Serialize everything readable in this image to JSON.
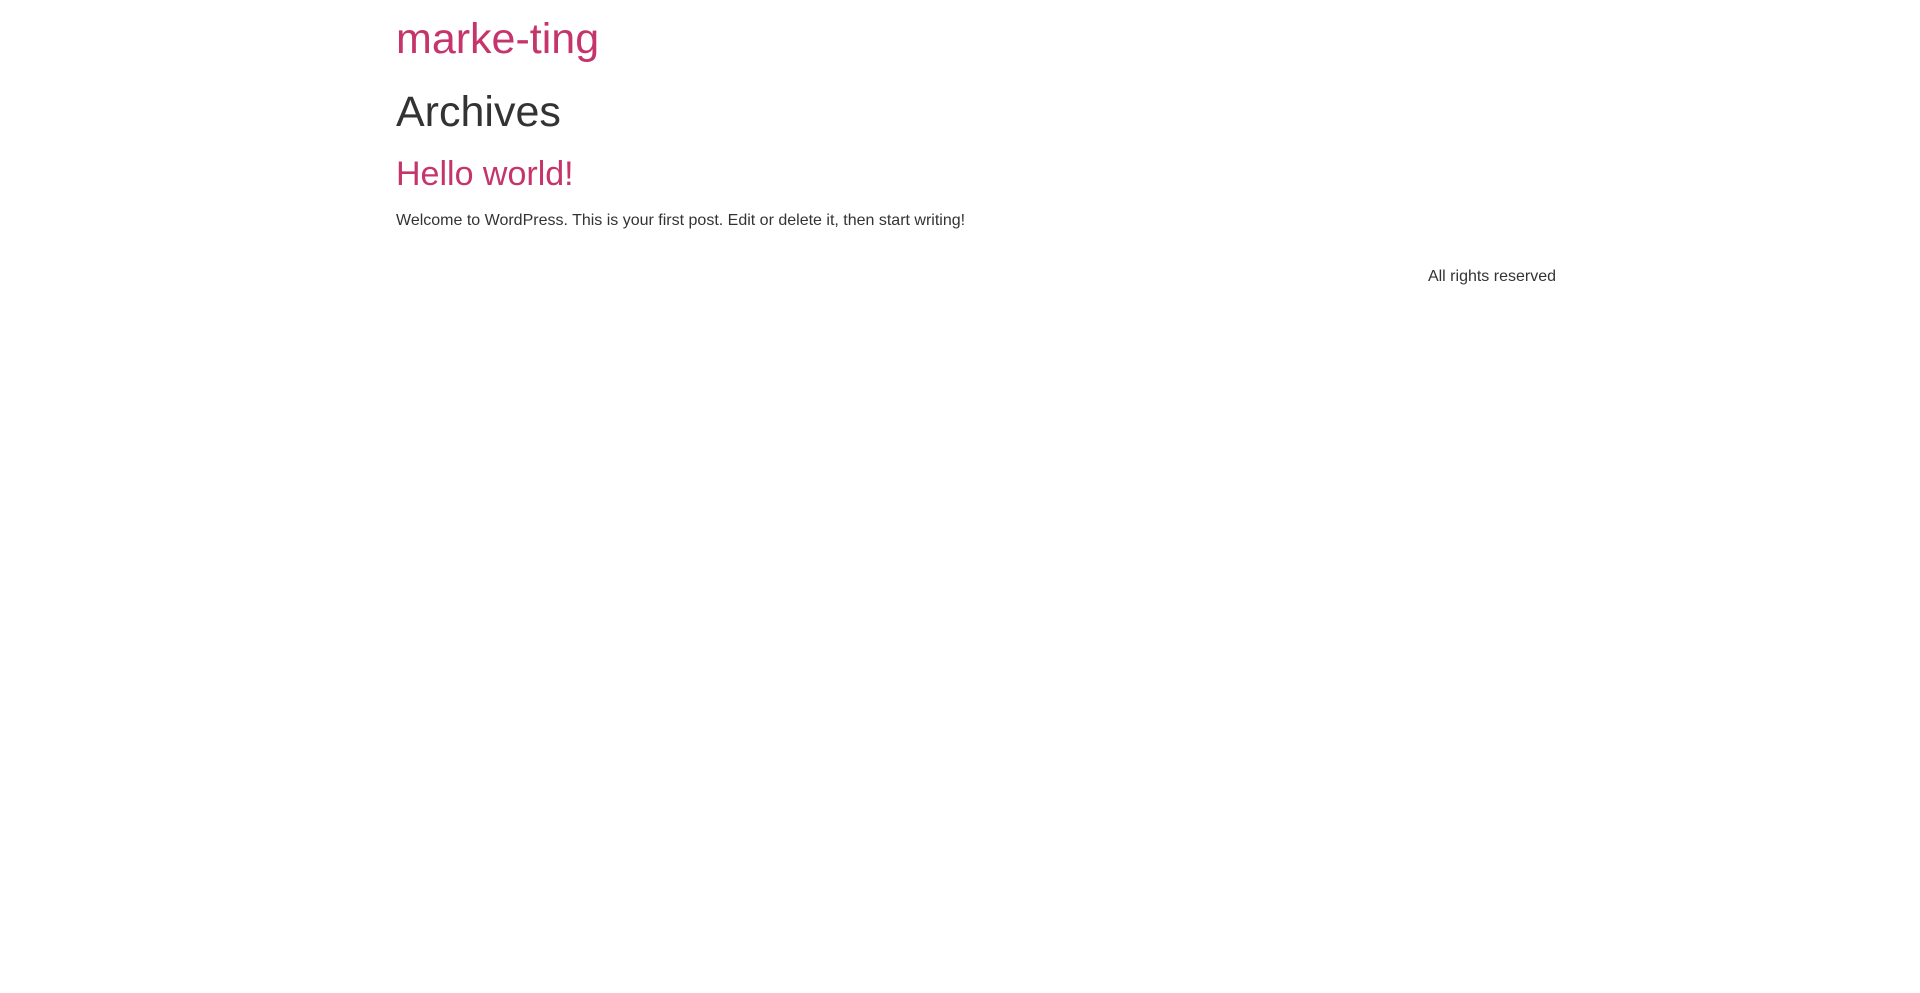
{
  "header": {
    "site_title": "marke-ting"
  },
  "main": {
    "page_title": "Archives",
    "posts": [
      {
        "title": "Hello world!",
        "excerpt": "Welcome to WordPress. This is your first post. Edit or delete it, then start writing!"
      }
    ]
  },
  "footer": {
    "copyright": "All rights reserved"
  },
  "colors": {
    "accent": "#c5356b",
    "text": "#333333",
    "background": "#ffffff"
  }
}
